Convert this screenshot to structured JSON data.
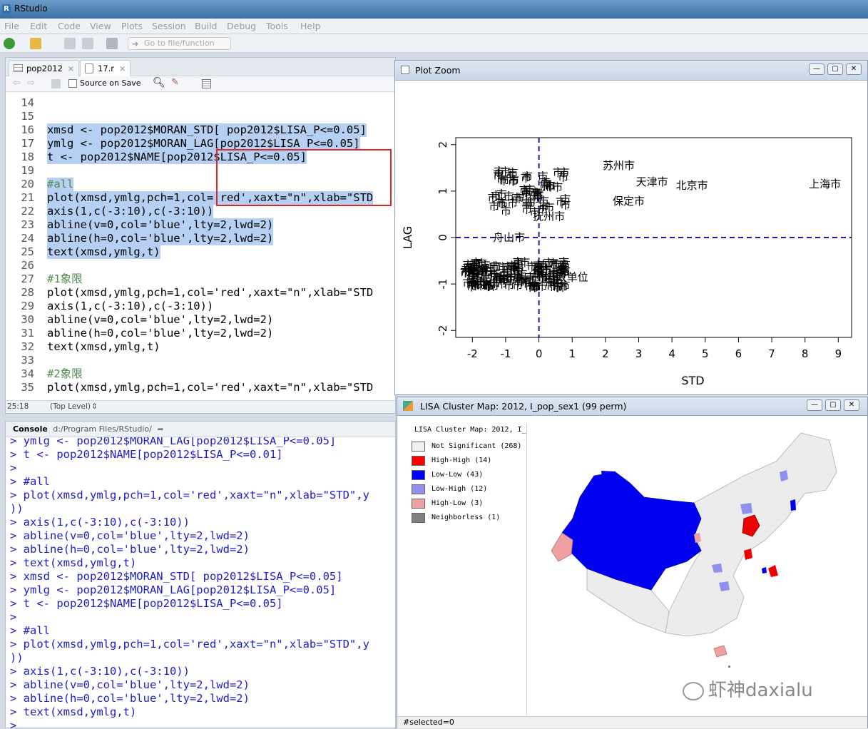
{
  "app": {
    "title": "RStudio"
  },
  "menu": [
    "File",
    "Edit",
    "Code",
    "View",
    "Plots",
    "Session",
    "Build",
    "Debug",
    "Tools",
    "Help"
  ],
  "toolbar": {
    "goto_placeholder": "Go to file/function"
  },
  "editor": {
    "tabs": [
      {
        "label": "pop2012",
        "active": false
      },
      {
        "label": "17.r",
        "active": true
      }
    ],
    "source_on_save": "Source on Save",
    "lines": [
      {
        "n": "14",
        "t": "",
        "sel": false
      },
      {
        "n": "15",
        "t": "",
        "sel": false
      },
      {
        "n": "16",
        "t": "xmsd <- pop2012$MORAN_STD[ pop2012$LISA_P<=0.05]",
        "sel": true
      },
      {
        "n": "17",
        "t": "ymlg <- pop2012$MORAN_LAG[pop2012$LISA_P<=0.05]",
        "sel": true
      },
      {
        "n": "18",
        "t": "t <- pop2012$NAME[pop2012$LISA_P<=0.05]",
        "sel": true
      },
      {
        "n": "19",
        "t": "",
        "sel": true
      },
      {
        "n": "20",
        "t": "#all",
        "sel": true
      },
      {
        "n": "21",
        "t": "plot(xmsd,ymlg,pch=1,col='red',xaxt=\"n\",xlab=\"STD",
        "sel": true
      },
      {
        "n": "22",
        "t": "axis(1,c(-3:10),c(-3:10))",
        "sel": true
      },
      {
        "n": "23",
        "t": "abline(v=0,col='blue',lty=2,lwd=2)",
        "sel": true
      },
      {
        "n": "24",
        "t": "abline(h=0,col='blue',lty=2,lwd=2)",
        "sel": true
      },
      {
        "n": "25",
        "t": "text(xmsd,ymlg,t)",
        "sel": true
      },
      {
        "n": "26",
        "t": "",
        "sel": false
      },
      {
        "n": "27",
        "t": "#1象限",
        "sel": false
      },
      {
        "n": "28",
        "t": "plot(xmsd,ymlg,pch=1,col='red',xaxt=\"n\",xlab=\"STD",
        "sel": false
      },
      {
        "n": "29",
        "t": "axis(1,c(-3:10),c(-3:10))",
        "sel": false
      },
      {
        "n": "30",
        "t": "abline(v=0,col='blue',lty=2,lwd=2)",
        "sel": false
      },
      {
        "n": "31",
        "t": "abline(h=0,col='blue',lty=2,lwd=2)",
        "sel": false
      },
      {
        "n": "32",
        "t": "text(xmsd,ymlg,t)",
        "sel": false
      },
      {
        "n": "33",
        "t": "",
        "sel": false
      },
      {
        "n": "34",
        "t": "#2象限",
        "sel": false
      },
      {
        "n": "35",
        "t": "plot(xmsd,ymlg,pch=1,col='red',xaxt=\"n\",xlab=\"STD",
        "sel": false
      }
    ],
    "status_pos": "25:18",
    "status_scope": "(Top Level)"
  },
  "console": {
    "header": "Console",
    "path": "d:/Program Files/RStudio/",
    "lines": [
      "> ymlg <- pop2012$MORAN_LAG[pop2012$LISA_P<=0.05]",
      "> t <- pop2012$NAME[pop2012$LISA_P<=0.01]",
      ">",
      "> #all",
      "> plot(xmsd,ymlg,pch=1,col='red',xaxt=\"n\",xlab=\"STD\",y",
      "))",
      "> axis(1,c(-3:10),c(-3:10))",
      "> abline(v=0,col='blue',lty=2,lwd=2)",
      "> abline(h=0,col='blue',lty=2,lwd=2)",
      "> text(xmsd,ymlg,t)",
      "> xmsd <- pop2012$MORAN_STD[ pop2012$LISA_P<=0.05]",
      "> ymlg <- pop2012$MORAN_LAG[pop2012$LISA_P<=0.05]",
      "> t <- pop2012$NAME[pop2012$LISA_P<=0.05]",
      ">",
      "> #all",
      "> plot(xmsd,ymlg,pch=1,col='red',xaxt=\"n\",xlab=\"STD\",y",
      "))",
      "> axis(1,c(-3:10),c(-3:10))",
      "> abline(v=0,col='blue',lty=2,lwd=2)",
      "> abline(h=0,col='blue',lty=2,lwd=2)",
      "> text(xmsd,ymlg,t)",
      ">"
    ]
  },
  "plot_zoom": {
    "title": "Plot Zoom"
  },
  "chart_data": {
    "type": "scatter",
    "title": "",
    "xlabel": "STD",
    "ylabel": "LAG",
    "xlim": [
      -2.5,
      9.4
    ],
    "ylim": [
      -2.15,
      2.15
    ],
    "x_ticks": [
      "-2",
      "-1",
      "0",
      "1",
      "2",
      "3",
      "4",
      "5",
      "6",
      "7",
      "8",
      "9"
    ],
    "y_ticks": [
      "-2",
      "-1",
      "0",
      "1",
      "2"
    ],
    "vline": 0,
    "hline": 0,
    "labeled_points": [
      {
        "x": 2.4,
        "y": 1.55,
        "label": "苏州市"
      },
      {
        "x": 3.4,
        "y": 1.2,
        "label": "天津市"
      },
      {
        "x": 4.6,
        "y": 1.12,
        "label": "北京市"
      },
      {
        "x": 2.7,
        "y": 0.78,
        "label": "保定市"
      },
      {
        "x": 8.6,
        "y": 1.15,
        "label": "上海市"
      },
      {
        "x": -0.9,
        "y": 0.0,
        "label": "舟山市"
      },
      {
        "x": 0.4,
        "y": 1.08,
        "label": "州市"
      },
      {
        "x": 0.3,
        "y": 0.45,
        "label": "抚州市"
      },
      {
        "x": 1.0,
        "y": -0.85,
        "label": "政单位"
      }
    ],
    "cluster_upper": {
      "xmin": -1.4,
      "xmax": 0.9,
      "ymin": 0.45,
      "ymax": 1.35
    },
    "cluster_lower": {
      "xmin": -2.3,
      "xmax": 0.8,
      "ymin": -1.15,
      "ymax": -0.6
    }
  },
  "lisa": {
    "title": "LISA Cluster Map: 2012, I_pop_sex1 (99 perm)",
    "legend_title": "LISA Cluster Map: 2012, I_",
    "legend": [
      {
        "label": "Not Significant (268)",
        "color": "#f0f0f0"
      },
      {
        "label": "High-High (14)",
        "color": "#ff0000"
      },
      {
        "label": "Low-Low (43)",
        "color": "#0000ff"
      },
      {
        "label": "Low-High (12)",
        "color": "#9090ee"
      },
      {
        "label": "High-Low (3)",
        "color": "#f0a0a0"
      },
      {
        "label": "Neighborless (1)",
        "color": "#808080"
      }
    ],
    "status": "#selected=0",
    "watermark": "虾神daxialu"
  }
}
